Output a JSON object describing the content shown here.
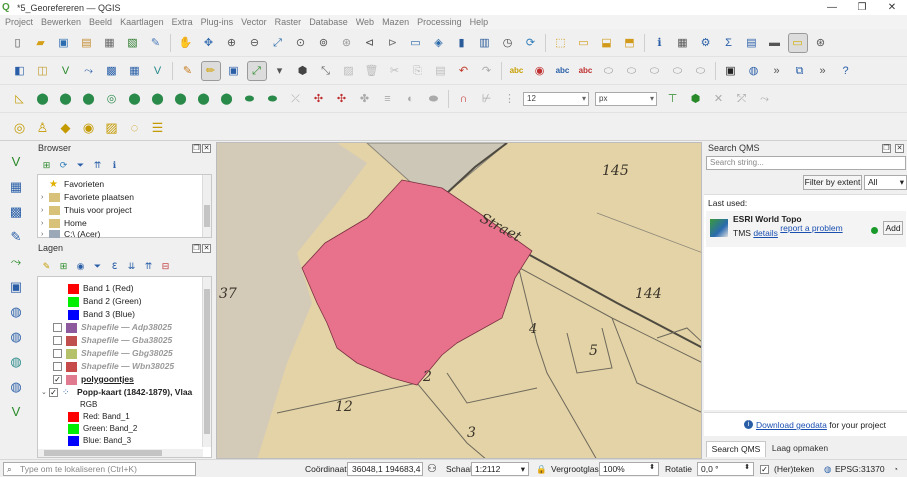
{
  "window": {
    "title": "*5_Georefereren — QGIS",
    "controls": [
      "—",
      "❐",
      "✕"
    ]
  },
  "menu": [
    "Project",
    "Bewerken",
    "Beeld",
    "Kaartlagen",
    "Extra",
    "Plug-ins",
    "Vector",
    "Raster",
    "Database",
    "Web",
    "Mazen",
    "Processing",
    "Help"
  ],
  "snapping": {
    "tolerance": "12",
    "unit": "px"
  },
  "browser": {
    "title": "Browser",
    "items": [
      {
        "label": "Favorieten",
        "icon": "star-icon"
      },
      {
        "label": "Favoriete plaatsen",
        "icon": "folder-icon"
      },
      {
        "label": "Thuis voor project",
        "icon": "folder-icon"
      },
      {
        "label": "Home",
        "icon": "folder-icon"
      },
      {
        "label": "C:\\ (Acer)",
        "icon": "drive-icon"
      }
    ]
  },
  "layers": {
    "title": "Lagen",
    "rows": [
      {
        "label": "Band 1 (Red)",
        "color": "#ff0000"
      },
      {
        "label": "Band 2 (Green)",
        "color": "#00ee00"
      },
      {
        "label": "Band 3 (Blue)",
        "color": "#0000ff"
      },
      {
        "label": "Shapefile — Adp38025",
        "color": "#8e5a9e",
        "checked": false
      },
      {
        "label": "Shapefile — Gba38025",
        "color": "#c0504d",
        "checked": false
      },
      {
        "label": "Shapefile — Gbg38025",
        "color": "#b5c26a",
        "checked": false
      },
      {
        "label": "Shapefile — Wbn38025",
        "color": "#c64a4a",
        "checked": false
      },
      {
        "label": "polygoontjes",
        "color": "#e07a8f",
        "checked": true
      },
      {
        "label": "Popp-kaart (1842-1879), Vlaa",
        "checked": true
      },
      {
        "label": "RGB"
      },
      {
        "label": "Red: Band_1",
        "color": "#ff0000"
      },
      {
        "label": "Green: Band_2",
        "color": "#00ee00"
      },
      {
        "label": "Blue: Band_3",
        "color": "#0000ff"
      }
    ]
  },
  "map": {
    "labels": [
      "145",
      "Straet",
      "144",
      "37",
      "4",
      "5",
      "2",
      "12",
      "3"
    ],
    "polygon_color": "#e8718c",
    "paper_color": "#e3d3a6"
  },
  "qms": {
    "title": "Search QMS",
    "search_placeholder": "Search string...",
    "filter_button": "Filter by extent",
    "filter_select": "All",
    "last_used_label": "Last used:",
    "result": {
      "name": "ESRI World Topo",
      "type": "TMS",
      "details_link": "details",
      "report_link": "report a problem",
      "status_color": "#1a9a2a",
      "add_button": "Add"
    },
    "footer_link": "Download geodata",
    "footer_text": " for your project",
    "tabs": [
      "Search QMS",
      "Laag opmaken"
    ]
  },
  "statusbar": {
    "locate_placeholder": "Type om te lokaliseren (Ctrl+K)",
    "coord_label": "Coördinaat",
    "coord_value": "36048,1  194683,4",
    "scale_label": "Schaal",
    "scale_value": "1:2112",
    "magnifier_label": "Vergrootglas",
    "magnifier_value": "100%",
    "rotation_label": "Rotatie",
    "rotation_value": "0,0 °",
    "render_label": "(Her)teken",
    "crs": "EPSG:31370"
  }
}
